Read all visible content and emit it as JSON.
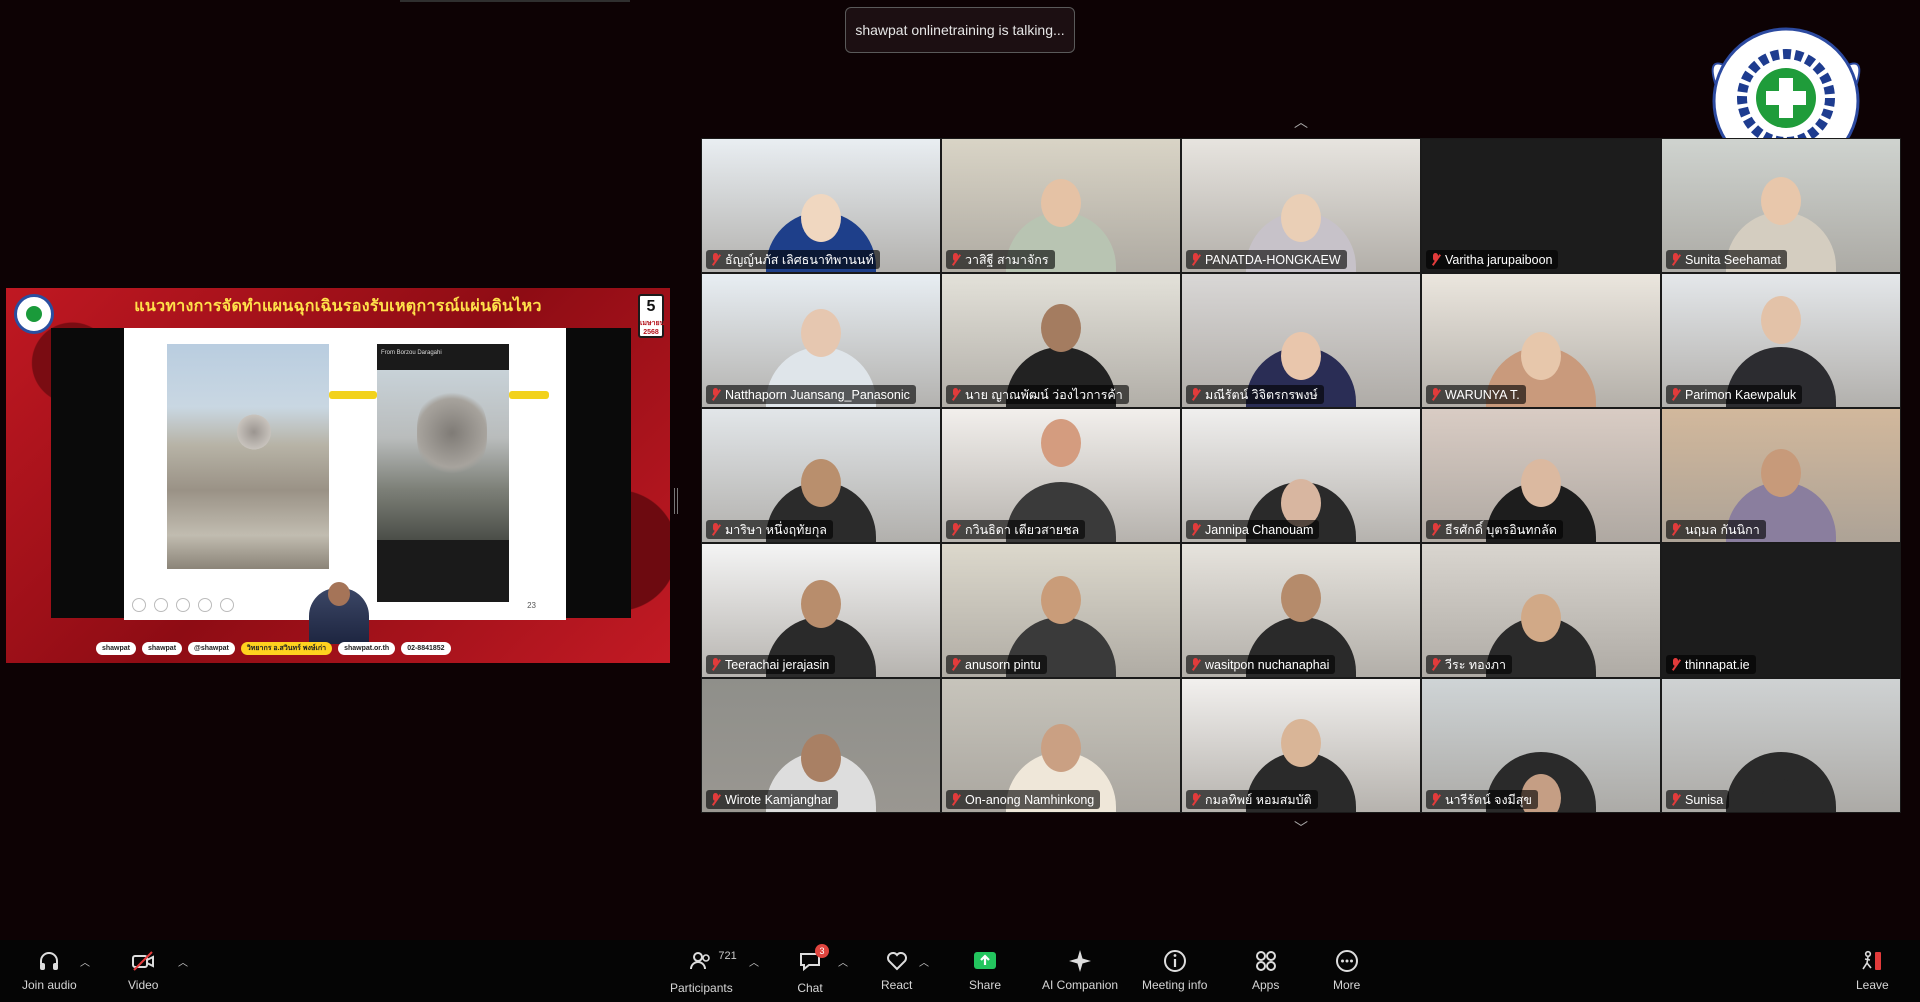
{
  "talking_indicator": "shawpat onlinetraining is talking...",
  "shared_slide": {
    "title": "แนวทางการจัดทำแผนฉุกเฉินรองรับเหตุการณ์แผ่นดินไหว",
    "date_day": "5",
    "date_month": "เมษายน",
    "date_year": "2568",
    "phone_header": "From Borzou Daragahi",
    "slide_number": "23",
    "contacts": [
      "shawpat",
      "shawpat",
      "@shawpat",
      "วิทยากร อ.สวินทร์ พงษ์เก่า",
      "shawpat.or.th",
      "02-8841852"
    ]
  },
  "participants_grid": [
    {
      "name": "ธัญญ์นภัส เลิศธนาทิพานนท์",
      "muted": true
    },
    {
      "name": "วาสิฐี สามาจักร",
      "muted": true
    },
    {
      "name": "PANATDA-HONGKAEW",
      "muted": true
    },
    {
      "name": "Varitha jarupaiboon",
      "muted": true
    },
    {
      "name": "Sunita Seehamat",
      "muted": true
    },
    {
      "name": "Natthaporn Juansang_Panasonic",
      "muted": true
    },
    {
      "name": "นาย ญาณพัฒน์ ว่องไวการค้า",
      "muted": true
    },
    {
      "name": "มณีรัตน์ วิจิตรกรพงษ์",
      "muted": true
    },
    {
      "name": "WARUNYA T.",
      "muted": true
    },
    {
      "name": "Parimon Kaewpaluk",
      "muted": true
    },
    {
      "name": "มาริษา หนึ่งฤทัยกุล",
      "muted": true
    },
    {
      "name": "กวินธิดา เตียวสายชล",
      "muted": true
    },
    {
      "name": "Jannipa Chanouam",
      "muted": true
    },
    {
      "name": "ธีรศักดิ์ บุตรอินทกลัด",
      "muted": true
    },
    {
      "name": "นฤมล กันนิกา",
      "muted": true
    },
    {
      "name": "Teerachai jerajasin",
      "muted": true
    },
    {
      "name": "anusorn pintu",
      "muted": true
    },
    {
      "name": "wasitpon nuchanaphai",
      "muted": true
    },
    {
      "name": "วีระ ทองภา",
      "muted": true
    },
    {
      "name": "thinnapat.ie",
      "muted": true
    },
    {
      "name": "Wirote Kamjanghar",
      "muted": true
    },
    {
      "name": "On-anong Namhinkong",
      "muted": true
    },
    {
      "name": "กมลทิพย์ หอมสมบัติ",
      "muted": true
    },
    {
      "name": "นารีรัตน์ จงมีสุข",
      "muted": true
    },
    {
      "name": "Sunisa",
      "muted": true
    }
  ],
  "toolbar": {
    "join_audio": "Join audio",
    "video": "Video",
    "participants": "Participants",
    "participants_count": "721",
    "chat": "Chat",
    "chat_badge": "3",
    "react": "React",
    "share": "Share",
    "ai_companion": "AI Companion",
    "meeting_info": "Meeting info",
    "apps": "Apps",
    "more": "More",
    "leave": "Leave"
  },
  "colors": {
    "background": "#0d0204",
    "share_green": "#23c55e",
    "muted_red": "#e23b3b",
    "slide_red": "#b5121b",
    "title_yellow": "#ffe14a"
  }
}
